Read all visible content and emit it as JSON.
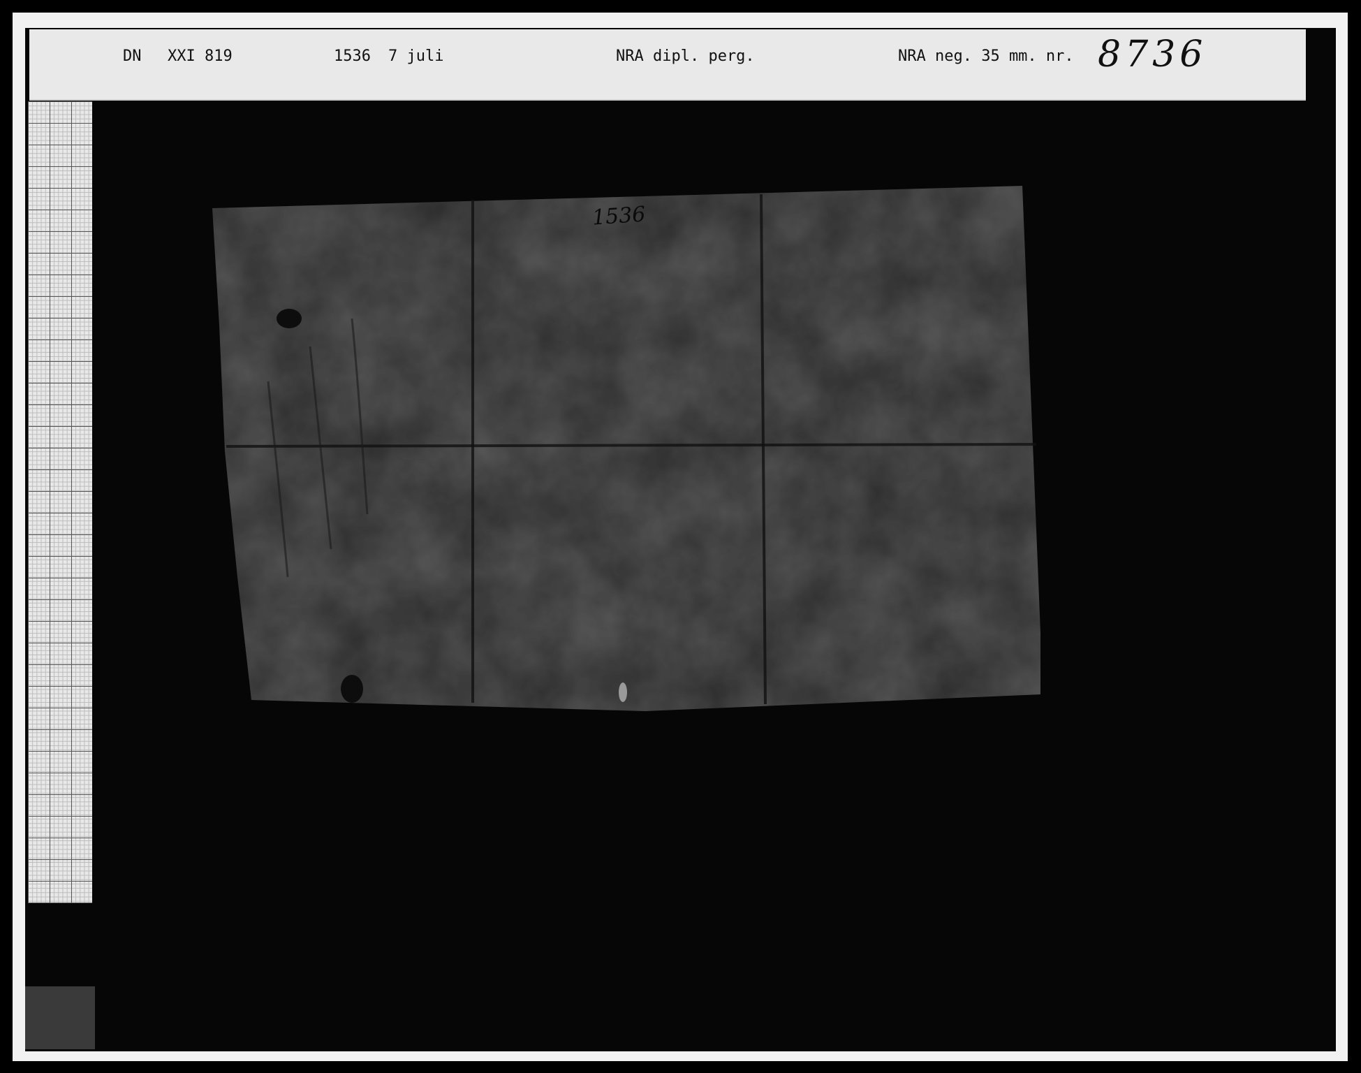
{
  "label": {
    "series": "DN",
    "volume_number": "XXI 819",
    "year": "1536",
    "date": "7 juli",
    "archive": "NRA dipl. perg.",
    "negative_label": "NRA neg. 35 mm. nr.",
    "negative_number": "8736"
  },
  "document": {
    "annotation": "1536"
  }
}
